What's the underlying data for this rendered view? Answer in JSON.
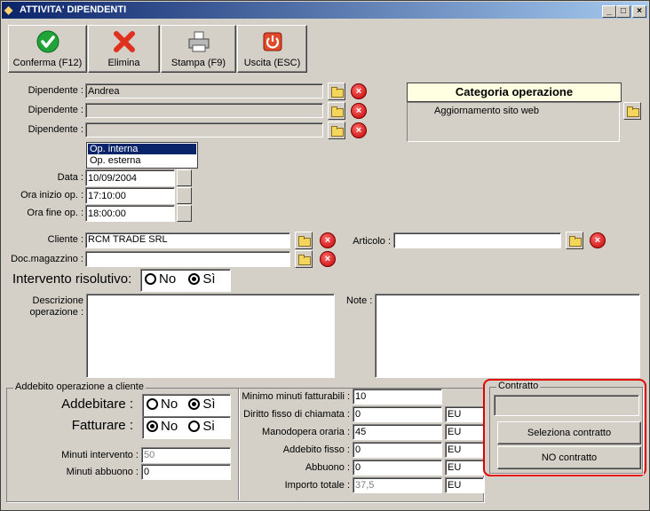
{
  "window": {
    "title": "ATTIVITA' DIPENDENTI"
  },
  "toolbar": {
    "confirm": "Conferma (F12)",
    "delete": "Elimina",
    "print": "Stampa (F9)",
    "exit": "Uscita (ESC)"
  },
  "employees": {
    "label": "Dipendente :",
    "values": [
      "Andrea",
      "",
      ""
    ]
  },
  "op_type": {
    "options": [
      "Op. interna",
      "Op. esterna"
    ],
    "selected": "Op. interna"
  },
  "date": {
    "label": "Data :",
    "value": "10/09/2004"
  },
  "start_time": {
    "label": "Ora inizio op. :",
    "value": "17:10:00"
  },
  "end_time": {
    "label": "Ora fine op. :",
    "value": "18:00:00"
  },
  "category": {
    "title": "Categoria operazione",
    "value": "Aggiornamento sito web"
  },
  "client": {
    "label": "Cliente :",
    "value": "RCM TRADE SRL"
  },
  "article": {
    "label": "Articolo :",
    "value": ""
  },
  "warehouse_doc": {
    "label": "Doc.magazzino :",
    "value": ""
  },
  "resolutive": {
    "label": "Intervento risolutivo:",
    "no": "No",
    "yes": "Sì",
    "selected": "no"
  },
  "description": {
    "label_1": "Descrizione",
    "label_2": "operazione :"
  },
  "notes": {
    "label": "Note :"
  },
  "billing": {
    "title": "Addebito operazione a cliente",
    "charge_label": "Addebitare :",
    "charge_no": "No",
    "charge_yes": "Sì",
    "charge_selected": "yes",
    "invoice_label": "Fatturare :",
    "invoice_no": "No",
    "invoice_yes": "Si",
    "invoice_selected": "no",
    "minutes_label": "Minuti intervento :",
    "minutes_value": "50",
    "discount_min_label": "Minuti abbuono :",
    "discount_min_value": "0"
  },
  "costs": {
    "min_billable_label": "Minimo minuti fatturabili :",
    "min_billable_value": "10",
    "call_fee_label": "Diritto fisso di chiamata :",
    "call_fee_value": "0",
    "call_fee_cur": "EU",
    "hourly_label": "Manodopera oraria :",
    "hourly_value": "45",
    "hourly_cur": "EU",
    "fixed_label": "Addebito fisso :",
    "fixed_value": "0",
    "fixed_cur": "EU",
    "discount_label": "Abbuono :",
    "discount_value": "0",
    "discount_cur": "EU",
    "total_label": "Importo totale :",
    "total_value": "37,5",
    "total_cur": "EU"
  },
  "contract": {
    "title": "Contratto",
    "value": "",
    "select_label": "Seleziona contratto",
    "none_label": "NO contratto",
    "highlight_color": "#e00000"
  }
}
